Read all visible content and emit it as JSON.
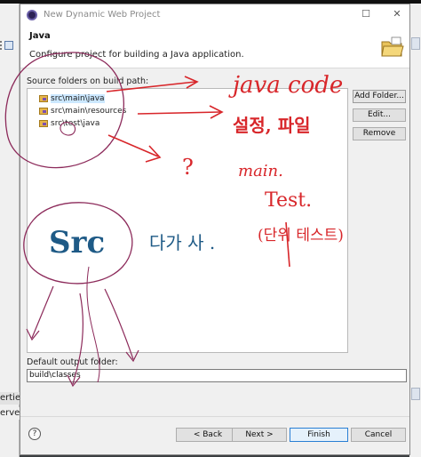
{
  "window": {
    "title": "New Dynamic Web Project",
    "minimize_glyph": "☐",
    "close_glyph": "✕"
  },
  "header": {
    "title": "Java",
    "description": "Configure project for building a Java application."
  },
  "source": {
    "label": "Source folders on build path:",
    "items": [
      {
        "label": "src\\main\\java",
        "selected": true
      },
      {
        "label": "src\\main\\resources",
        "selected": false
      },
      {
        "label": "src\\test\\java",
        "selected": false
      }
    ]
  },
  "side_buttons": {
    "add_folder": "Add Folder...",
    "edit": "Edit...",
    "remove": "Remove"
  },
  "output": {
    "label": "Default output folder:",
    "value": "build\\classes"
  },
  "footer": {
    "help": "?",
    "back": "< Back",
    "next": "Next >",
    "finish": "Finish",
    "cancel": "Cancel"
  },
  "background": {
    "left_text_1": "erties",
    "left_text_2": "erver"
  },
  "annotations": {
    "java_code": "java code",
    "setting_file": "설정, 파일",
    "question": "?",
    "main": "main.",
    "test": "Test.",
    "unit_test": "(단위 테스트)",
    "src": "Src",
    "multi": "다가 사 ."
  },
  "colors": {
    "ink_red": "#d8262a",
    "ink_purple": "#8c2a5a",
    "ink_blue": "#1e5a86",
    "selection": "#cce8ff"
  },
  "icons": {
    "app": "eclipse-icon",
    "header": "folder-icon",
    "tree": "package-folder-icon"
  }
}
